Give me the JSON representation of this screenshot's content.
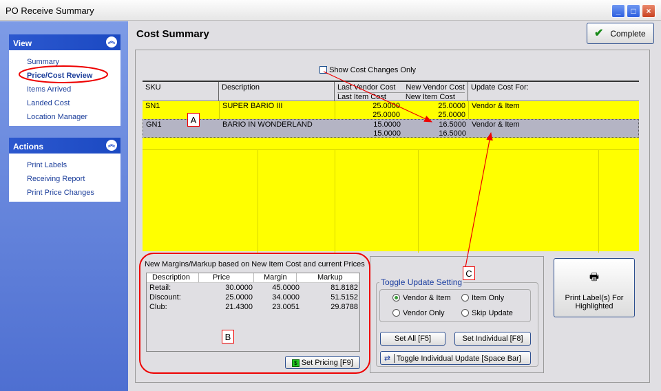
{
  "window": {
    "title": "PO Receive Summary"
  },
  "sidebar": {
    "view": {
      "title": "View",
      "items": [
        {
          "label": "Summary"
        },
        {
          "label": "Price/Cost Review"
        },
        {
          "label": "Items Arrived"
        },
        {
          "label": "Landed Cost"
        },
        {
          "label": "Location Manager"
        }
      ],
      "selected": "Price/Cost Review"
    },
    "actions": {
      "title": "Actions",
      "items": [
        {
          "label": "Print Labels"
        },
        {
          "label": "Receiving Report"
        },
        {
          "label": "Print Price Changes"
        }
      ]
    }
  },
  "header": {
    "title": "Cost Summary",
    "complete_label": "Complete"
  },
  "filter": {
    "label": "Show Cost Changes Only",
    "checked": false
  },
  "grid": {
    "headers": {
      "sku": "SKU",
      "description": "Description",
      "last_vendor": "Last Vendor Cost",
      "last_item": "Last Item Cost",
      "new_vendor": "New Vendor Cost",
      "new_item": "New Item Cost",
      "update": "Update Cost For:"
    },
    "rows": [
      {
        "sku": "SN1",
        "description": "SUPER BARIO III",
        "last_vendor_cost": "25.0000",
        "new_vendor_cost": "25.0000",
        "last_item_cost": "25.0000",
        "new_item_cost": "25.0000",
        "update": "Vendor & Item"
      },
      {
        "sku": "GN1",
        "description": "BARIO IN WONDERLAND",
        "last_vendor_cost": "15.0000",
        "new_vendor_cost": "16.5000",
        "last_item_cost": "15.0000",
        "new_item_cost": "16.5000",
        "update": "Vendor & Item",
        "highlighted": true
      }
    ]
  },
  "margins": {
    "caption": "New Margins/Markup based on New Item Cost and current Prices",
    "columns": [
      "Description",
      "Price",
      "Margin",
      "Markup"
    ],
    "rows": [
      {
        "description": "Retail:",
        "price": "30.0000",
        "margin": "45.0000",
        "markup": "81.8182"
      },
      {
        "description": "Discount:",
        "price": "25.0000",
        "margin": "34.0000",
        "markup": "51.5152"
      },
      {
        "description": "Club:",
        "price": "21.4300",
        "margin": "23.0051",
        "markup": "29.8788"
      }
    ],
    "set_pricing_label": "Set Pricing [F9]"
  },
  "toggle": {
    "legend": "Toggle Update Setting",
    "options": [
      {
        "label": "Vendor & Item",
        "selected": true
      },
      {
        "label": "Item Only"
      },
      {
        "label": "Vendor Only"
      },
      {
        "label": "Skip Update"
      }
    ],
    "set_all_label": "Set All [F5]",
    "set_individual_label": "Set Individual [F8]",
    "toggle_individual_label": "Toggle Individual Update [Space Bar]"
  },
  "print": {
    "label": "Print Label(s) For Highlighted"
  },
  "annotations": {
    "a": "A",
    "b": "B",
    "c": "C",
    "color": "#e00000"
  },
  "colors": {
    "grid_bg": "#ffff00",
    "highlight_row": "#b4b4c4",
    "sidebar_header": "#2c58cf"
  }
}
